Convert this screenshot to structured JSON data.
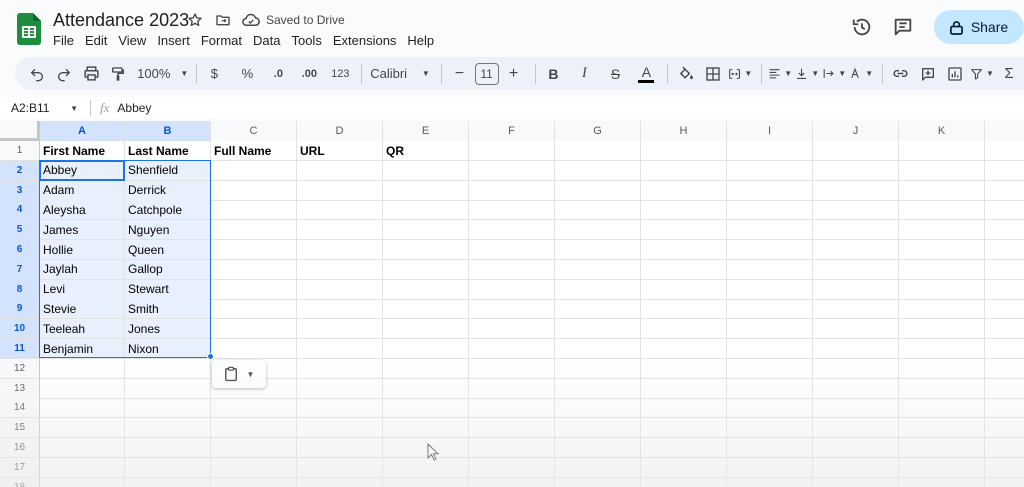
{
  "document": {
    "title": "Attendance 2023",
    "save_status": "Saved to Drive"
  },
  "menu": [
    "File",
    "Edit",
    "View",
    "Insert",
    "Format",
    "Data",
    "Tools",
    "Extensions",
    "Help"
  ],
  "header_right": {
    "share_label": "Share"
  },
  "toolbar": {
    "zoom": "100%",
    "currency": "$",
    "percent": "%",
    "decrease_decimal": ".0",
    "increase_decimal": ".00",
    "more_formats": "123",
    "font": "Calibri",
    "font_size": "11",
    "bold": "B",
    "italic": "I",
    "strikethrough": "S",
    "text_color_letter": "A"
  },
  "formula_bar": {
    "name_box": "A2:B11",
    "fx": "fx",
    "value": "Abbey"
  },
  "columns": [
    "A",
    "B",
    "C",
    "D",
    "E",
    "F",
    "G",
    "H",
    "I",
    "J",
    "K"
  ],
  "row_numbers": [
    "1",
    "2",
    "3",
    "4",
    "5",
    "6",
    "7",
    "8",
    "9",
    "10",
    "11",
    "12",
    "13",
    "14",
    "15",
    "16",
    "17",
    "18"
  ],
  "cells": [
    [
      "First Name",
      "Last Name",
      "Full Name",
      "URL",
      "QR"
    ],
    [
      "Abbey",
      "Shenfield"
    ],
    [
      "Adam",
      "Derrick"
    ],
    [
      "Aleysha",
      "Catchpole"
    ],
    [
      "James",
      "Nguyen"
    ],
    [
      "Hollie",
      "Queen"
    ],
    [
      "Jaylah",
      "Gallop"
    ],
    [
      "Levi",
      "Stewart"
    ],
    [
      "Stevie",
      "Smith"
    ],
    [
      "Teeleah",
      "Jones"
    ],
    [
      "Benjamin",
      "Nixon"
    ]
  ],
  "selection": {
    "range": "A2:B11",
    "active_cell": "A2"
  },
  "colors": {
    "accent": "#1a73e8",
    "share_bg": "#c2e7ff",
    "selection_fill": "#e8f0fe",
    "header_selected": "#d3e3fd",
    "sheets_green": "#188038"
  },
  "icons": {
    "logo": "google-sheets-logo",
    "star": "star-icon",
    "move": "move-to-folder-icon",
    "cloud": "cloud-saved-icon",
    "history": "version-history-icon",
    "comments": "comments-icon",
    "lock": "lock-icon",
    "paste": "paste-clipboard-icon"
  }
}
